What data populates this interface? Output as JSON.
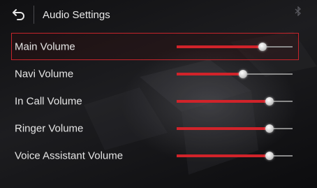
{
  "header": {
    "title": "Audio Settings",
    "back_icon": "back-arrow-icon",
    "status_icon": "bluetooth-icon"
  },
  "colors": {
    "accent": "#d1232a",
    "selection_border": "#c6242b",
    "track": "#8a8a8a"
  },
  "volumes": [
    {
      "label": "Main Volume",
      "level": 0.74,
      "selected": true
    },
    {
      "label": "Navi Volume",
      "level": 0.57,
      "selected": false
    },
    {
      "label": "In Call Volume",
      "level": 0.8,
      "selected": false
    },
    {
      "label": "Ringer Volume",
      "level": 0.8,
      "selected": false
    },
    {
      "label": "Voice Assistant Volume",
      "level": 0.8,
      "selected": false
    }
  ]
}
